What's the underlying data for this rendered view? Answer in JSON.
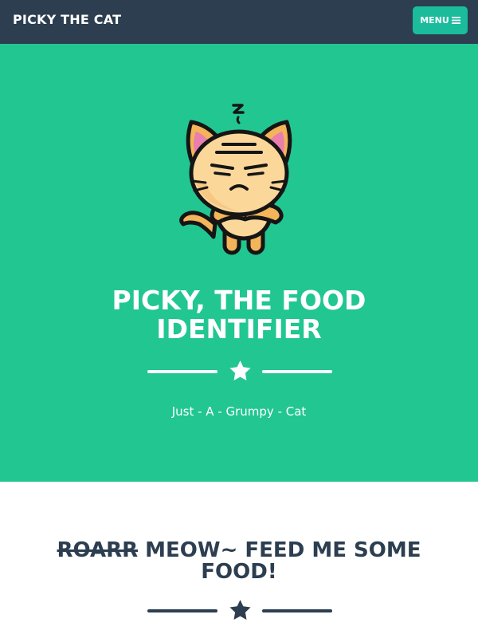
{
  "navbar": {
    "brand": "PICKY THE CAT",
    "menu_label": "MENU",
    "menu_icon": "hamburger-icon"
  },
  "masthead": {
    "avatar_icon": "grumpy-cat-icon",
    "title_line1": "PICKY, THE FOOD",
    "title_line2": "IDENTIFIER",
    "divider_icon": "star-icon",
    "subtitle": "Just - A - Grumpy - Cat"
  },
  "section": {
    "title_struck": "ROARR",
    "title_rest": " MEOW~ FEED ME SOME",
    "title_line2": "FOOD!",
    "divider_icon": "star-icon"
  },
  "colors": {
    "navbar_bg": "#2c3e50",
    "masthead_bg": "#22c690",
    "button_bg": "#1abc9c",
    "heading_dark": "#2c3e50",
    "text_light": "#ffffff"
  }
}
